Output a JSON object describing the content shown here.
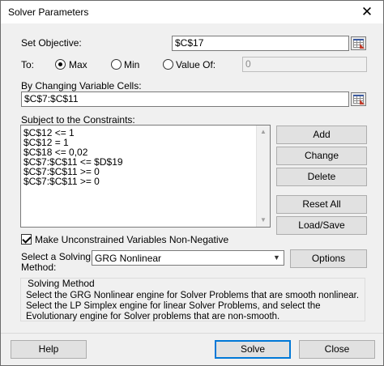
{
  "window": {
    "title": "Solver Parameters",
    "close_glyph": "✕"
  },
  "objective": {
    "label": "Set Objective:",
    "value": "$C$17"
  },
  "to": {
    "label": "To:",
    "options": [
      {
        "label": "Max",
        "selected": true
      },
      {
        "label": "Min",
        "selected": false
      },
      {
        "label": "Value Of:",
        "selected": false
      }
    ],
    "value_of": "0"
  },
  "changing_cells": {
    "label": "By Changing Variable Cells:",
    "value": "$C$7:$C$11"
  },
  "constraints": {
    "label": "Subject to the Constraints:",
    "items": [
      "$C$12 <= 1",
      "$C$12 = 1",
      "$C$18 <= 0,02",
      "$C$7:$C$11 <= $D$19",
      "$C$7:$C$11 >= 0",
      "$C$7:$C$11 >= 0"
    ],
    "buttons": {
      "add": "Add",
      "change": "Change",
      "delete": "Delete",
      "reset": "Reset All",
      "load_save": "Load/Save"
    }
  },
  "nonneg": {
    "label": "Make Unconstrained Variables Non-Negative",
    "checked": true
  },
  "method": {
    "label_line1": "Select a Solving",
    "label_line2": "Method:",
    "selected": "GRG Nonlinear",
    "options_button": "Options"
  },
  "solving_method": {
    "title": "Solving Method",
    "description": "Select the GRG Nonlinear engine for Solver Problems that are smooth nonlinear. Select the LP Simplex engine for linear Solver Problems, and select the Evolutionary engine for Solver problems that are non-smooth."
  },
  "footer": {
    "help": "Help",
    "solve": "Solve",
    "close": "Close"
  },
  "icons": {
    "collapse": "range-select-icon",
    "dropdown": "chevron-down-icon",
    "scroll_up": "scroll-up-icon",
    "scroll_down": "scroll-down-icon"
  },
  "colors": {
    "default_button_border": "#0078d7",
    "dialog_bg": "#f0f0f0"
  }
}
